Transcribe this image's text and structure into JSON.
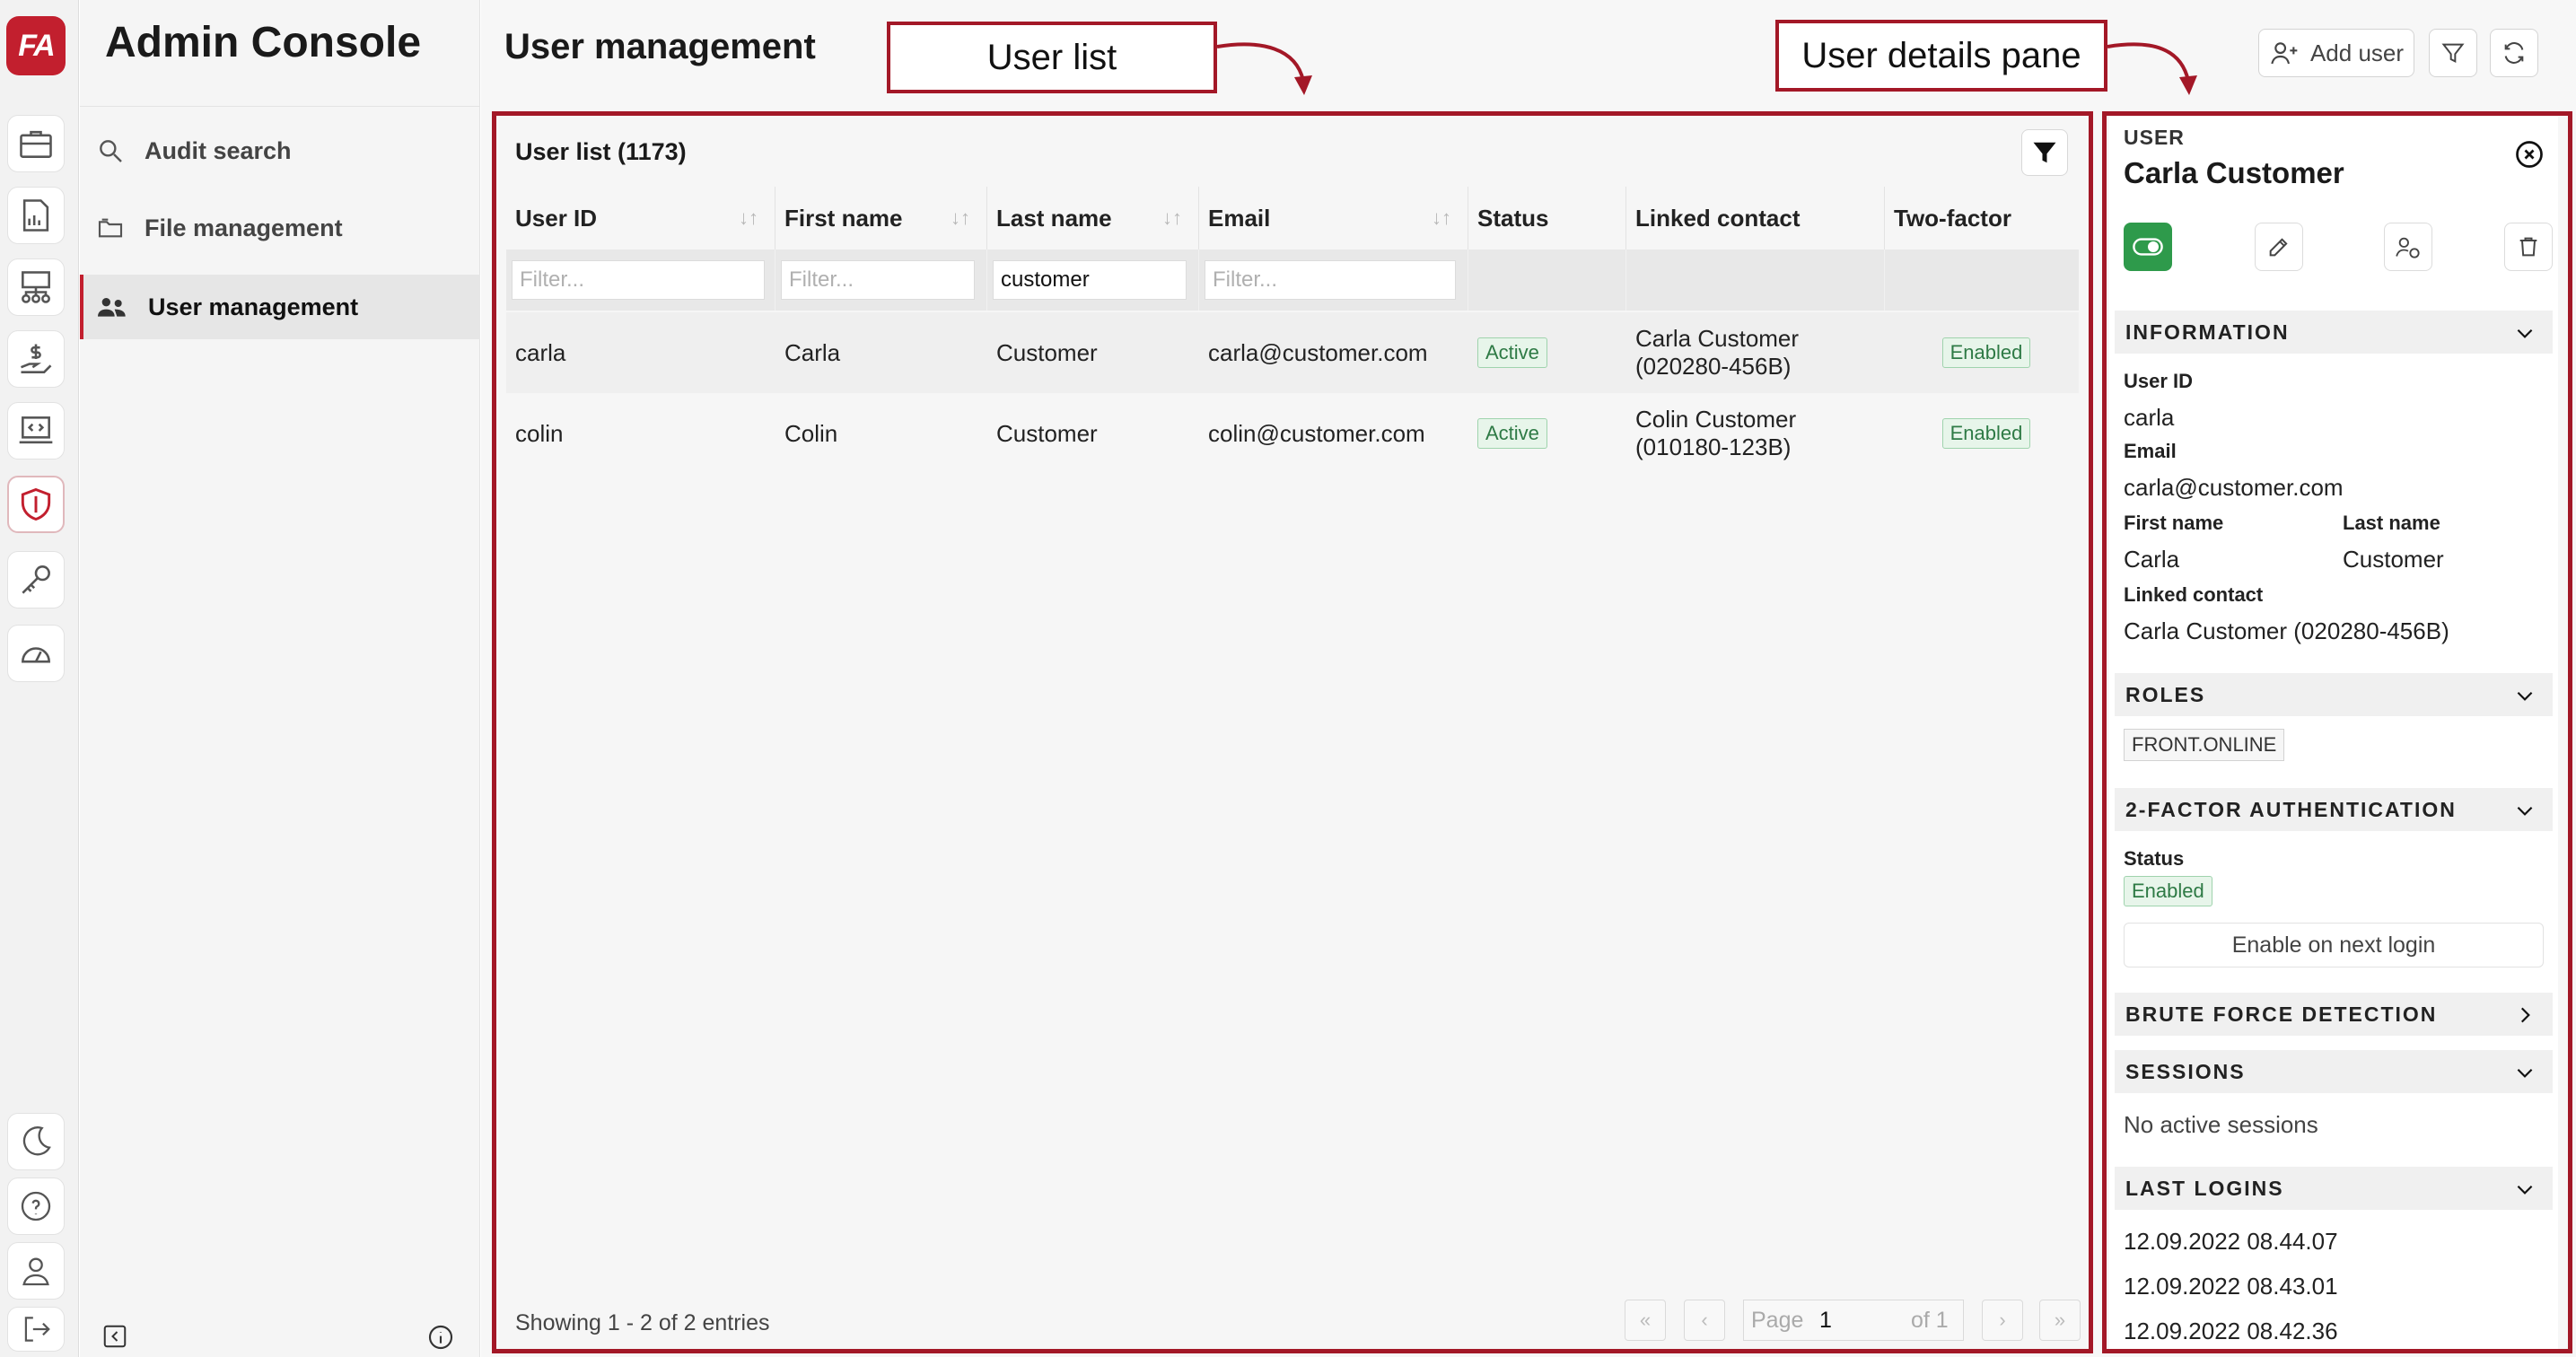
{
  "app": {
    "title": "Admin Console",
    "logo_text": "FA",
    "brand_color": "#c21f2e",
    "annotation_color": "#a31827"
  },
  "rail_icons": [
    "briefcase-icon",
    "report-chart-icon",
    "network-icon",
    "money-hand-icon",
    "code-laptop-icon",
    "shield-icon",
    "key-icon",
    "gauge-icon"
  ],
  "rail_bottom_icons": [
    "moon-icon",
    "help-icon",
    "user-icon",
    "logout-icon"
  ],
  "nav": {
    "items": [
      {
        "label": "Audit search",
        "icon": "search-icon"
      },
      {
        "label": "File management",
        "icon": "folder-icon"
      },
      {
        "label": "User management",
        "icon": "users-icon",
        "selected": true
      }
    ]
  },
  "page": {
    "title": "User management"
  },
  "callouts": {
    "user_list": "User list",
    "details": "User details pane"
  },
  "toolbar": {
    "add_user": "Add user"
  },
  "user_list": {
    "title": "User list (1173)",
    "columns": [
      "User ID",
      "First name",
      "Last name",
      "Email",
      "Status",
      "Linked contact",
      "Two-factor"
    ],
    "filters": {
      "placeholder": "Filter...",
      "last_name_value": "customer"
    },
    "rows": [
      {
        "user_id": "carla",
        "first": "Carla",
        "last": "Customer",
        "email": "carla@customer.com",
        "status": "Active",
        "contact_name": "Carla Customer",
        "contact_id": "(020280-456B)",
        "two_factor": "Enabled"
      },
      {
        "user_id": "colin",
        "first": "Colin",
        "last": "Customer",
        "email": "colin@customer.com",
        "status": "Active",
        "contact_name": "Colin Customer",
        "contact_id": "(010180-123B)",
        "two_factor": "Enabled"
      }
    ],
    "footer": {
      "showing": "Showing 1 - 2 of 2 entries",
      "page_label": "Page",
      "page_value": "1",
      "of_label": "of 1"
    }
  },
  "details": {
    "label": "USER",
    "name": "Carla Customer",
    "information": {
      "heading": "INFORMATION",
      "user_id_label": "User ID",
      "user_id": "carla",
      "email_label": "Email",
      "email": "carla@customer.com",
      "first_label": "First name",
      "first": "Carla",
      "last_label": "Last name",
      "last": "Customer",
      "contact_label": "Linked contact",
      "contact": "Carla Customer (020280-456B)"
    },
    "roles": {
      "heading": "ROLES",
      "items": [
        "FRONT.ONLINE"
      ]
    },
    "twofa": {
      "heading": "2-FACTOR AUTHENTICATION",
      "status_label": "Status",
      "status": "Enabled",
      "button": "Enable on next login"
    },
    "brute": {
      "heading": "BRUTE FORCE DETECTION"
    },
    "sessions": {
      "heading": "SESSIONS",
      "text": "No active sessions"
    },
    "logins": {
      "heading": "LAST LOGINS",
      "items": [
        "12.09.2022 08.44.07",
        "12.09.2022 08.43.01",
        "12.09.2022 08.42.36"
      ]
    }
  }
}
